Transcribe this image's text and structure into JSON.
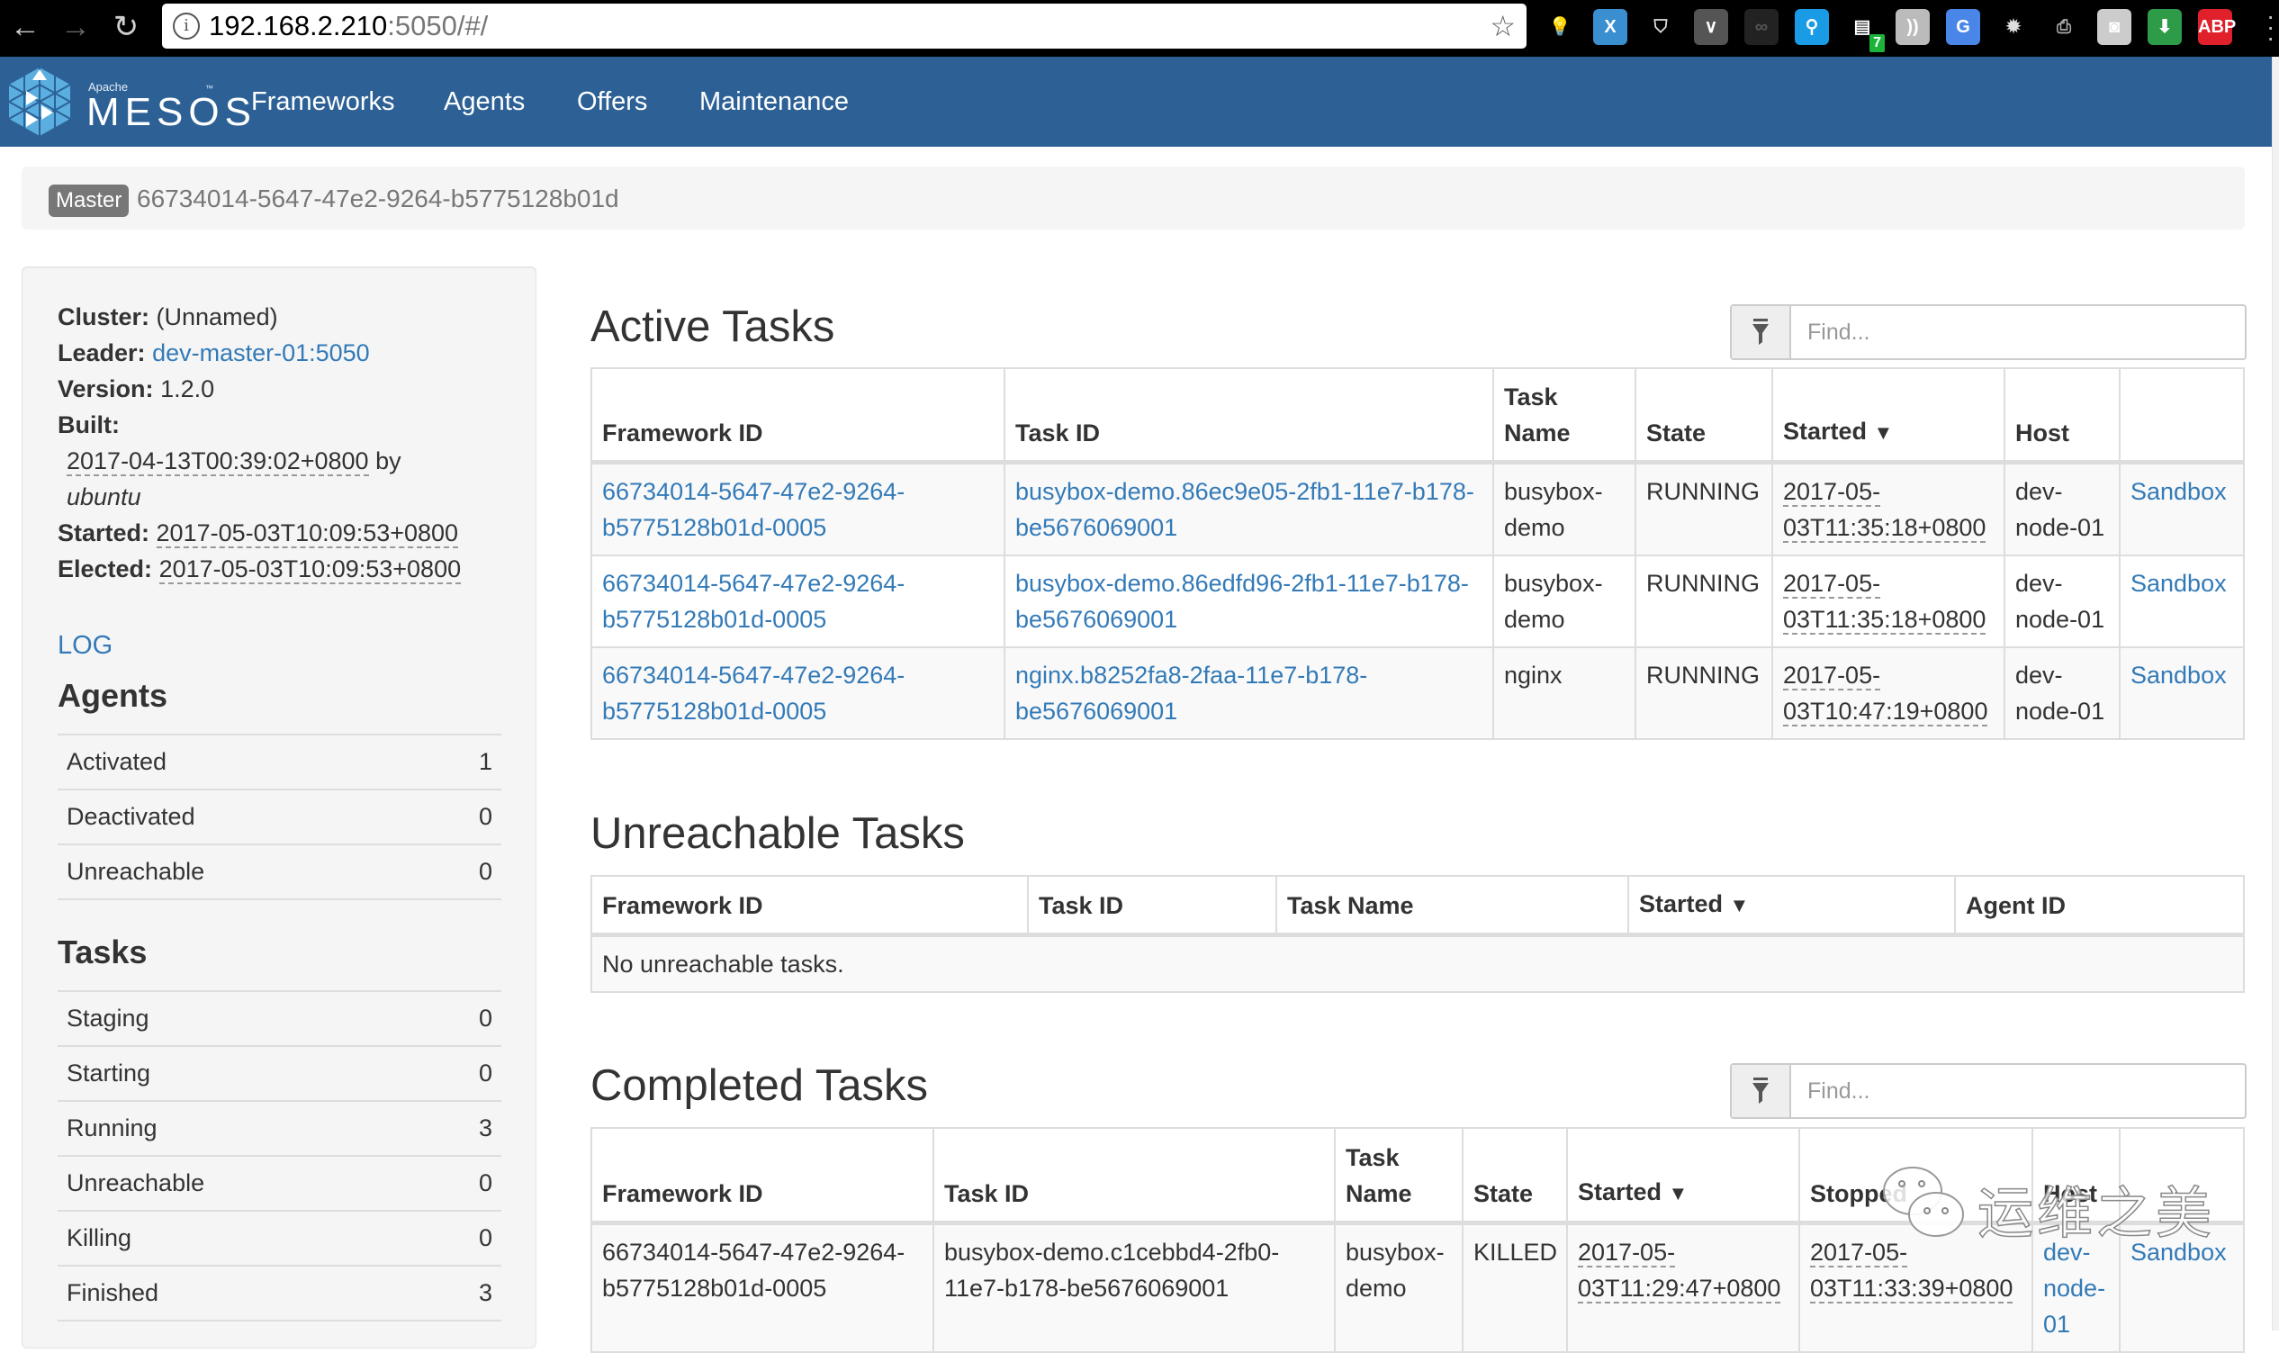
{
  "browser": {
    "url_host": "192.168.2.210",
    "url_rest": ":5050/#/",
    "extensions": [
      {
        "name": "lightbulb-extension-icon",
        "bg": "#000000",
        "fg": "#5fb4f0",
        "glyph": "💡"
      },
      {
        "name": "x-extension-icon",
        "bg": "#3a8fd0",
        "fg": "#ffffff",
        "glyph": "X"
      },
      {
        "name": "shield-extension-icon",
        "bg": "#000000",
        "fg": "#dddddd",
        "glyph": "⛉"
      },
      {
        "name": "pocket-extension-icon",
        "bg": "#555555",
        "fg": "#ffffff",
        "glyph": "∨"
      },
      {
        "name": "glasses-extension-icon",
        "bg": "#222222",
        "fg": "#555555",
        "glyph": "∞"
      },
      {
        "name": "search-extension-icon",
        "bg": "#1a9be6",
        "fg": "#ffffff",
        "glyph": "⚲"
      },
      {
        "name": "badge-extension-icon",
        "bg": "#000000",
        "fg": "#ffffff",
        "glyph": "▤",
        "badge": "7"
      },
      {
        "name": "rss-extension-icon",
        "bg": "#bbbbbb",
        "fg": "#ffffff",
        "glyph": "))"
      },
      {
        "name": "translate-extension-icon",
        "bg": "#4a86e8",
        "fg": "#ffffff",
        "glyph": "G"
      },
      {
        "name": "burst-extension-icon",
        "bg": "#000000",
        "fg": "#dddddd",
        "glyph": "✹"
      },
      {
        "name": "camera-roll-extension-icon",
        "bg": "#000000",
        "fg": "#aaaaaa",
        "glyph": "⎙"
      },
      {
        "name": "screenshot-extension-icon",
        "bg": "#cccccc",
        "fg": "#ffffff",
        "glyph": "◙"
      },
      {
        "name": "download-extension-icon",
        "bg": "#2e9b48",
        "fg": "#ffffff",
        "glyph": "⬇"
      },
      {
        "name": "adblock-extension-icon",
        "bg": "#e0202a",
        "fg": "#ffffff",
        "glyph": "ABP"
      }
    ]
  },
  "navbar": {
    "brand_small": "Apache",
    "brand": "MESOS",
    "tm": "™",
    "items": [
      "Frameworks",
      "Agents",
      "Offers",
      "Maintenance"
    ]
  },
  "master": {
    "badge": "Master",
    "id": "66734014-5647-47e2-9264-b5775128b01d"
  },
  "sidebar": {
    "cluster_label": "Cluster:",
    "cluster_value": "(Unnamed)",
    "leader_label": "Leader:",
    "leader_value": "dev-master-01:5050",
    "version_label": "Version:",
    "version_value": "1.2.0",
    "built_label": "Built:",
    "built_date": "2017-04-13T00:39:02+0800",
    "built_by": "by",
    "built_user": "ubuntu",
    "started_label": "Started:",
    "started_value": "2017-05-03T10:09:53+0800",
    "elected_label": "Elected:",
    "elected_value": "2017-05-03T10:09:53+0800",
    "log_link": "LOG",
    "agents_heading": "Agents",
    "agents": [
      {
        "label": "Activated",
        "value": "1"
      },
      {
        "label": "Deactivated",
        "value": "0"
      },
      {
        "label": "Unreachable",
        "value": "0"
      }
    ],
    "tasks_heading": "Tasks",
    "tasks": [
      {
        "label": "Staging",
        "value": "0"
      },
      {
        "label": "Starting",
        "value": "0"
      },
      {
        "label": "Running",
        "value": "3"
      },
      {
        "label": "Unreachable",
        "value": "0"
      },
      {
        "label": "Killing",
        "value": "0"
      },
      {
        "label": "Finished",
        "value": "3"
      }
    ]
  },
  "active": {
    "title": "Active Tasks",
    "find_placeholder": "Find...",
    "headers": [
      "Framework ID",
      "Task ID",
      "Task Name",
      "State",
      "Started",
      "Host",
      ""
    ],
    "sort_caret": "▼",
    "rows": [
      {
        "framework_id": "66734014-5647-47e2-9264-b5775128b01d-0005",
        "task_id": "busybox-demo.86ec9e05-2fb1-11e7-b178-be5676069001",
        "task_name": "busybox-demo",
        "state": "RUNNING",
        "started": "2017-05-03T11:35:18+0800",
        "host": "dev-node-01",
        "sandbox": "Sandbox"
      },
      {
        "framework_id": "66734014-5647-47e2-9264-b5775128b01d-0005",
        "task_id": "busybox-demo.86edfd96-2fb1-11e7-b178-be5676069001",
        "task_name": "busybox-demo",
        "state": "RUNNING",
        "started": "2017-05-03T11:35:18+0800",
        "host": "dev-node-01",
        "sandbox": "Sandbox"
      },
      {
        "framework_id": "66734014-5647-47e2-9264-b5775128b01d-0005",
        "task_id": "nginx.b8252fa8-2faa-11e7-b178-be5676069001",
        "task_name": "nginx",
        "state": "RUNNING",
        "started": "2017-05-03T10:47:19+0800",
        "host": "dev-node-01",
        "sandbox": "Sandbox"
      }
    ]
  },
  "unreachable": {
    "title": "Unreachable Tasks",
    "headers": [
      "Framework ID",
      "Task ID",
      "Task Name",
      "Started",
      "Agent ID"
    ],
    "sort_caret": "▼",
    "empty": "No unreachable tasks."
  },
  "completed": {
    "title": "Completed Tasks",
    "find_placeholder": "Find...",
    "headers": [
      "Framework ID",
      "Task ID",
      "Task Name",
      "State",
      "Started",
      "Stopped",
      "Host",
      ""
    ],
    "sort_caret": "▼",
    "rows": [
      {
        "framework_id": "66734014-5647-47e2-9264-b5775128b01d-0005",
        "task_id": "busybox-demo.c1cebbd4-2fb0-11e7-b178-be5676069001",
        "task_name": "busybox-demo",
        "state": "KILLED",
        "started": "2017-05-03T11:29:47+0800",
        "stopped": "2017-05-03T11:33:39+0800",
        "host": "dev-node-01",
        "sandbox": "Sandbox"
      }
    ]
  },
  "watermark": "运维之美",
  "colors": {
    "navbar": "#2d6196",
    "link": "#337ab7",
    "badge": "#777777"
  }
}
